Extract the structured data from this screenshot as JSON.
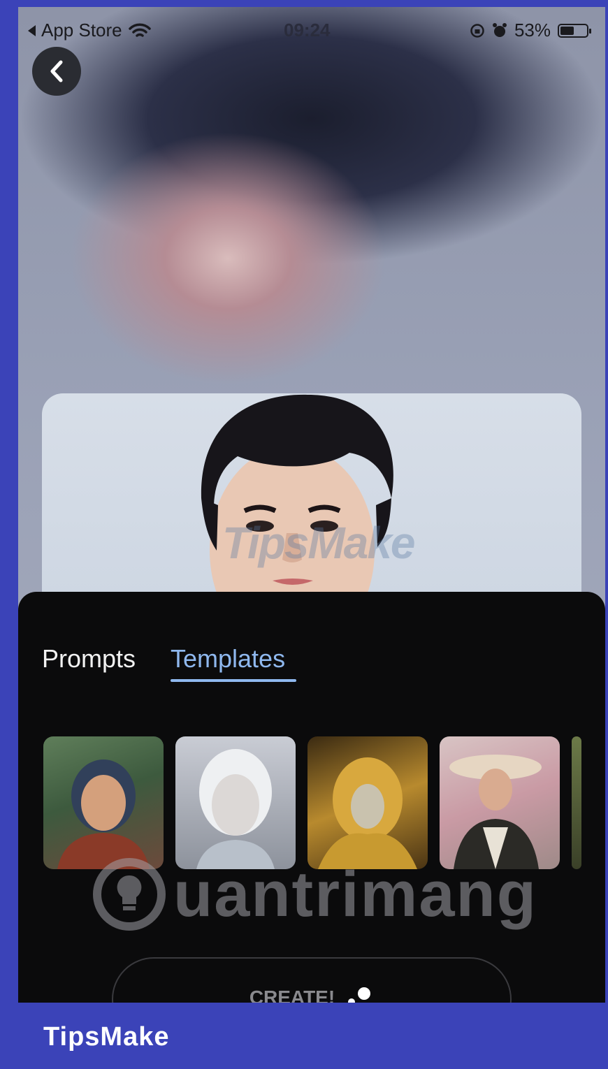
{
  "status_bar": {
    "carrier": "App Store",
    "time": "09:24",
    "battery_text": "53%",
    "battery_level": 0.53,
    "icons": [
      "back-triangle-icon",
      "wifi-icon",
      "orientation-lock-icon",
      "alarm-icon",
      "battery-icon"
    ]
  },
  "nav": {
    "back_icon": "chevron-left-icon"
  },
  "photo": {
    "watermark": "TipsMake"
  },
  "tabs": [
    {
      "label": "Prompts",
      "active": false
    },
    {
      "label": "Templates",
      "active": true
    }
  ],
  "templates": [
    {
      "name": "template-girl-outdoor"
    },
    {
      "name": "template-white-android"
    },
    {
      "name": "template-golden-warrior"
    },
    {
      "name": "template-woman-hat"
    }
  ],
  "create_button": {
    "label": "CREATE!",
    "icon": "sparkle-dots-icon"
  },
  "watermark_center": "uantrimang",
  "brand_footer": "TipsMake",
  "colors": {
    "accent_tab": "#8fb8ee",
    "sheet_bg": "#0b0b0c",
    "frame": "#3b43b8"
  }
}
